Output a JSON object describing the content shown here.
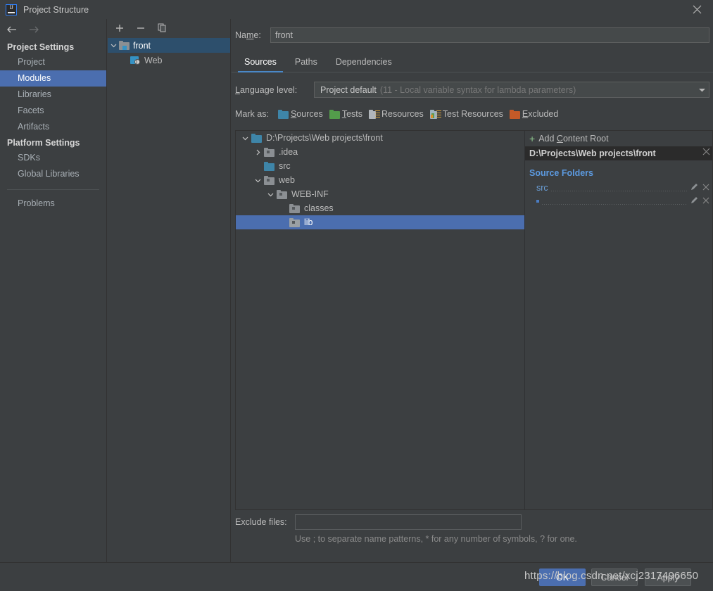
{
  "window": {
    "title": "Project Structure",
    "logo_icon": "intellij-idea-logo-icon",
    "close_icon": "close-icon"
  },
  "nav": {
    "back_icon": "arrow-left-icon",
    "forward_icon": "arrow-right-icon",
    "sections": [
      {
        "heading": "Project Settings",
        "items": [
          {
            "label": "Project",
            "selected": false
          },
          {
            "label": "Modules",
            "selected": true
          },
          {
            "label": "Libraries",
            "selected": false
          },
          {
            "label": "Facets",
            "selected": false
          },
          {
            "label": "Artifacts",
            "selected": false
          }
        ]
      },
      {
        "heading": "Platform Settings",
        "items": [
          {
            "label": "SDKs",
            "selected": false
          },
          {
            "label": "Global Libraries",
            "selected": false
          }
        ]
      }
    ],
    "problems_label": "Problems",
    "help_label": "?"
  },
  "modules_panel": {
    "toolbar": {
      "add_icon": "plus-icon",
      "remove_icon": "minus-icon",
      "copy_icon": "copy-icon"
    },
    "tree": [
      {
        "label": "front",
        "indent": 0,
        "twisty": "expanded",
        "icon": "module-folder-icon",
        "selected": true
      },
      {
        "label": "Web",
        "indent": 1,
        "twisty": "none",
        "icon": "web-facet-icon",
        "selected": false
      }
    ]
  },
  "main": {
    "name_label": "Name:",
    "name_label_mnemonic": "m",
    "name_value": "front",
    "name_placeholder": "",
    "tabs": [
      {
        "label": "Sources",
        "active": true
      },
      {
        "label": "Paths",
        "active": false
      },
      {
        "label": "Dependencies",
        "active": false
      }
    ],
    "language_level": {
      "label": "Language level:",
      "value": "Project default",
      "hint": "(11 - Local variable syntax for lambda parameters)",
      "dropdown_icon": "chevron-down-icon"
    },
    "mark_as": {
      "label": "Mark as:",
      "options": [
        {
          "label": "Sources",
          "mnemonic": "S",
          "color": "#3e85a8",
          "icon": "folder-sources-icon"
        },
        {
          "label": "Tests",
          "mnemonic": "T",
          "color": "#539c4b",
          "icon": "folder-tests-icon"
        },
        {
          "label": "Resources",
          "mnemonic": "",
          "color": "#b0b5ba",
          "icon": "folder-resources-icon"
        },
        {
          "label": "Test Resources",
          "mnemonic": "",
          "color": "#8fa5b0",
          "icon": "folder-test-resources-icon"
        },
        {
          "label": "Excluded",
          "mnemonic": "E",
          "color": "#c45a28",
          "icon": "folder-excluded-icon"
        }
      ]
    },
    "content_tree": [
      {
        "label": "D:\\Projects\\Web projects\\front",
        "indent": 0,
        "twisty": "expanded",
        "folder_color": "#3e85a8",
        "selected": false
      },
      {
        "label": ".idea",
        "indent": 1,
        "twisty": "collapsed",
        "folder_color": "#8b8f93",
        "selected": false
      },
      {
        "label": "src",
        "indent": 1,
        "twisty": "none",
        "folder_color": "#3e85a8",
        "selected": false
      },
      {
        "label": "web",
        "indent": 1,
        "twisty": "expanded",
        "folder_color": "#8b8f93",
        "selected": false
      },
      {
        "label": "WEB-INF",
        "indent": 2,
        "twisty": "expanded",
        "folder_color": "#8b8f93",
        "selected": false
      },
      {
        "label": "classes",
        "indent": 3,
        "twisty": "none",
        "folder_color": "#8b8f93",
        "selected": false
      },
      {
        "label": "lib",
        "indent": 3,
        "twisty": "none",
        "folder_color": "#8b8f93",
        "selected": true
      }
    ],
    "right_panel": {
      "add_content_root_label": "Add Content Root",
      "add_icon": "plus-icon",
      "content_root_path": "D:\\Projects\\Web projects\\front",
      "remove_root_icon": "close-icon",
      "source_folders_title": "Source Folders",
      "source_folders": [
        {
          "name": "src",
          "edit_icon": "pencil-icon",
          "remove_icon": "close-icon"
        },
        {
          "name": "",
          "edit_icon": "pencil-icon",
          "remove_icon": "close-icon"
        }
      ]
    },
    "exclude": {
      "label": "Exclude files:",
      "value": "",
      "placeholder": "",
      "hint": "Use ; to separate name patterns, * for any number of symbols, ? for one."
    }
  },
  "footer": {
    "buttons": [
      {
        "label": "OK",
        "primary": true
      },
      {
        "label": "Cancel",
        "primary": false
      },
      {
        "label": "Apply",
        "primary": false
      }
    ],
    "watermark": "https://blog.csdn.net/xcj2317496650"
  },
  "colors": {
    "background": "#3c3f41",
    "selection": "#4b6eaf",
    "tree_selection": "#2d4f6c",
    "accent_link": "#5c9ae0",
    "tab_underline": "#4a88c7",
    "header_dark": "#2b2b2b"
  }
}
